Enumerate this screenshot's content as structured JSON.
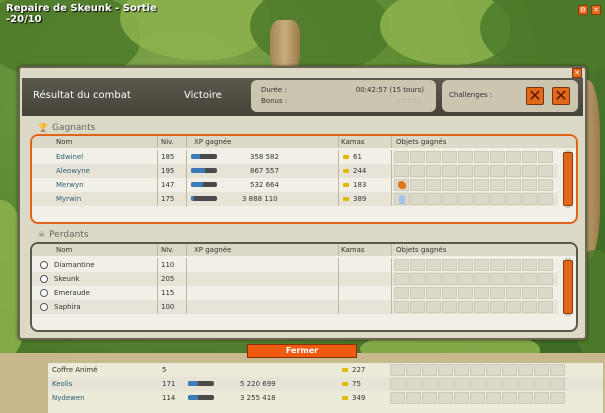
{
  "map": {
    "title_line1": "Repaire de Skeunk - Sortie",
    "title_line2": "-20/10"
  },
  "modal": {
    "title": "Résultat du combat",
    "outcome": "Victoire",
    "duration_label": "Durée :",
    "duration_value": "00:42:57 (15 tours)",
    "bonus_label": "Bonus :",
    "bonus_stars": "☆☆☆☆☆",
    "challenges_label": "Challenges :",
    "close_button": "Fermer"
  },
  "columns": {
    "name": "Nom",
    "level": "Niv.",
    "xp": "XP gagnée",
    "kamas": "Kamas",
    "items": "Objets gagnés"
  },
  "winners": {
    "title": "Gagnants",
    "rows": [
      {
        "name": "Edwinel",
        "level": "185",
        "xp": "358 582",
        "xp_fill": 0.35,
        "kamas": "61"
      },
      {
        "name": "Aleowyne",
        "level": "195",
        "xp": "867 557",
        "xp_fill": 0.55,
        "kamas": "244"
      },
      {
        "name": "Merwyn",
        "level": "147",
        "xp": "532 664",
        "xp_fill": 0.45,
        "kamas": "183"
      },
      {
        "name": "Myrwin",
        "level": "175",
        "xp": "3 888 110",
        "xp_fill": 0.1,
        "kamas": "389"
      }
    ]
  },
  "losers": {
    "title": "Perdants",
    "rows": [
      {
        "name": "Diamantine",
        "level": "110"
      },
      {
        "name": "Skeunk",
        "level": "205"
      },
      {
        "name": "Emeraude",
        "level": "115"
      },
      {
        "name": "Saphira",
        "level": "100"
      }
    ]
  },
  "background_table": {
    "rows": [
      {
        "name": "Coffre Animé",
        "level": "5",
        "xp": "",
        "kamas": "227"
      },
      {
        "name": "Keolis",
        "level": "171",
        "xp": "5 220 699",
        "xp_fill": 0.4,
        "kamas": "75"
      },
      {
        "name": "Nydewen",
        "level": "114",
        "xp": "3 255 418",
        "xp_fill": 0.4,
        "kamas": "349"
      }
    ]
  },
  "colors": {
    "accent": "#e06a1a",
    "header_bg": "#4e4b40",
    "panel_bg": "#dcd9c7",
    "link": "#2a5f78"
  }
}
